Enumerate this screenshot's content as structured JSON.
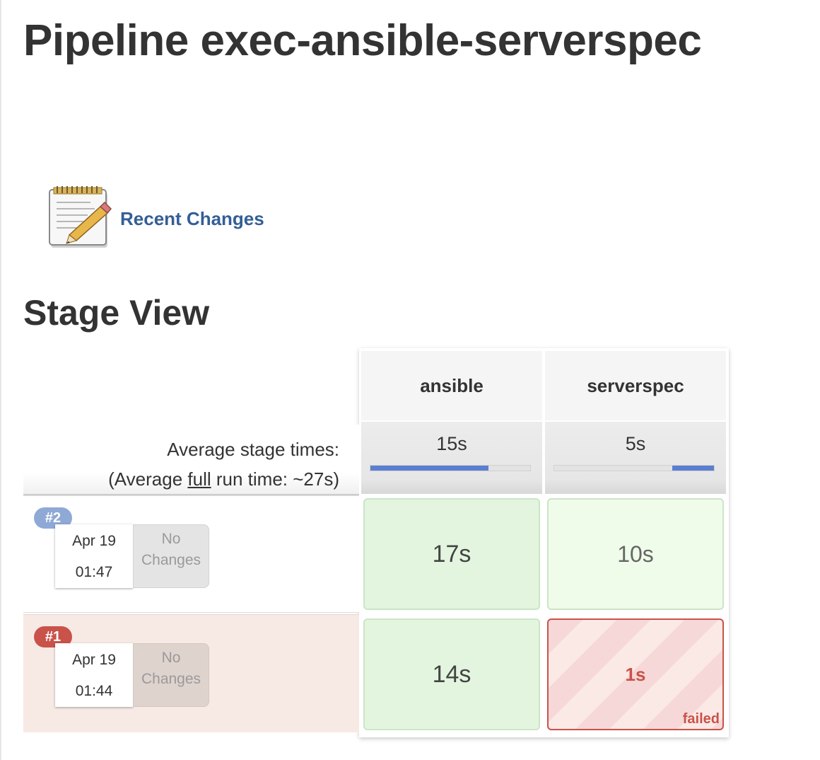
{
  "page": {
    "title": "Pipeline exec-ansible-serverspec",
    "recent_changes": "Recent Changes",
    "section_title": "Stage View"
  },
  "stage_view": {
    "columns": [
      {
        "name": "ansible",
        "avg_time": "15s",
        "avg_bar_fraction": 0.74
      },
      {
        "name": "serverspec",
        "avg_time": "5s",
        "avg_bar_fraction": 0.26
      }
    ],
    "avg_label_line1": "Average stage times:",
    "avg_label_prefix": "(Average ",
    "avg_label_full": "full",
    "avg_label_suffix": " run time: ~27s)",
    "builds": [
      {
        "number": "#2",
        "date": "Apr 19",
        "time": "01:47",
        "changes": "No Changes",
        "stages": [
          {
            "duration": "17s",
            "status": "success"
          },
          {
            "duration": "10s",
            "status": "success"
          }
        ]
      },
      {
        "number": "#1",
        "date": "Apr 19",
        "time": "01:44",
        "changes": "No Changes",
        "stages": [
          {
            "duration": "14s",
            "status": "success"
          },
          {
            "duration": "1s",
            "status": "failed",
            "status_label": "failed"
          }
        ]
      }
    ]
  },
  "colors": {
    "link": "#345e95",
    "success_bg": "#e3f5df",
    "failed": "#c9524a",
    "build_badge_ok": "#8fa9d6",
    "build_badge_failed": "#c9524a",
    "avg_bar": "#5b7fd0"
  },
  "icons": {
    "recent_changes": "notepad-pencil-icon"
  }
}
